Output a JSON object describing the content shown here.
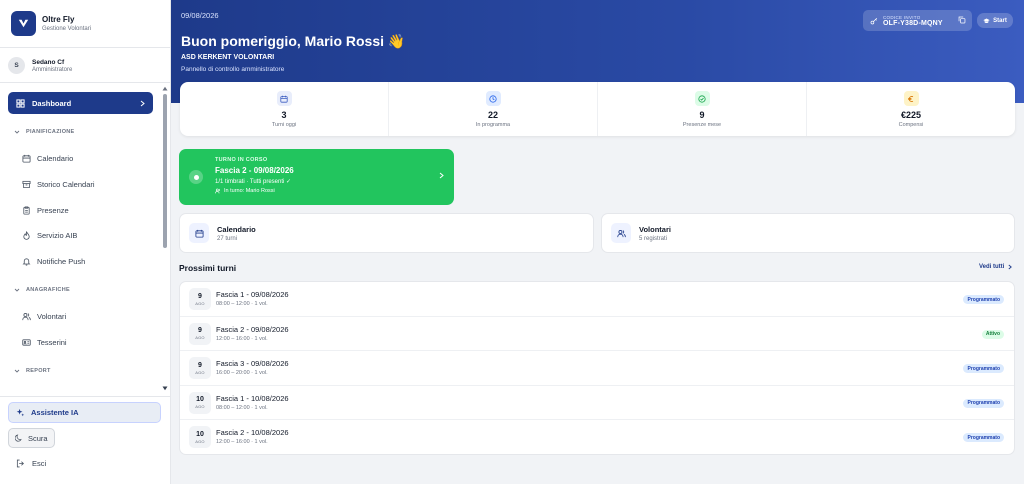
{
  "brand": {
    "name": "Oltre Fly",
    "subtitle": "Gestione Volontari"
  },
  "user": {
    "initial": "S",
    "name": "Sedano Cf",
    "role": "Amministratore"
  },
  "nav": {
    "dashboard": "Dashboard",
    "sections": {
      "pianificazione": "PIANIFICAZIONE",
      "anagrafiche": "ANAGRAFICHE",
      "report": "REPORT"
    },
    "items": {
      "calendario": "Calendario",
      "storico": "Storico Calendari",
      "presenze": "Presenze",
      "aib": "Servizio AIB",
      "notifiche": "Notifiche Push",
      "volontari": "Volontari",
      "tesserini": "Tesserini"
    },
    "assistente": "Assistente IA",
    "scura": "Scura",
    "esci": "Esci"
  },
  "header": {
    "date": "09/08/2026",
    "greeting": "Buon pomeriggio, Mario Rossi 👋",
    "org": "ASD KERKENT VOLONTARI",
    "panel": "Pannello di controllo amministratore",
    "invite_label": "CODICE INVITO",
    "invite_code": "OLF-Y38D-MQNY",
    "start": "Start"
  },
  "stats": [
    {
      "value": "3",
      "label": "Turni oggi",
      "color": "#3b5cc0",
      "bg": "#e8edfb"
    },
    {
      "value": "22",
      "label": "In programma",
      "color": "#2563eb",
      "bg": "#e0ebff"
    },
    {
      "value": "9",
      "label": "Presenze mese",
      "color": "#16a34a",
      "bg": "#dcfce7"
    },
    {
      "value": "€225",
      "label": "Compensi",
      "color": "#d97706",
      "bg": "#fef3c7"
    }
  ],
  "shift": {
    "badge": "TURNO IN CORSO",
    "title": "Fascia 2 - 09/08/2026",
    "status": "1/1 timbrati · Tutti presenti ✓",
    "who": "In turno: Mario Rossi"
  },
  "quick": {
    "calendario": {
      "title": "Calendario",
      "sub": "27 turni"
    },
    "volontari": {
      "title": "Volontari",
      "sub": "5 registrati"
    }
  },
  "upcoming": {
    "title": "Prossimi turni",
    "link": "Vedi tutti",
    "rows": [
      {
        "day": "9",
        "month": "AGO",
        "title": "Fascia 1 - 09/08/2026",
        "sub": "08:00 – 12:00 · 1 vol.",
        "status": "Programmato",
        "kind": "blue"
      },
      {
        "day": "9",
        "month": "AGO",
        "title": "Fascia 2 - 09/08/2026",
        "sub": "12:00 – 16:00 · 1 vol.",
        "status": "Attivo",
        "kind": "green"
      },
      {
        "day": "9",
        "month": "AGO",
        "title": "Fascia 3 - 09/08/2026",
        "sub": "16:00 – 20:00 · 1 vol.",
        "status": "Programmato",
        "kind": "blue"
      },
      {
        "day": "10",
        "month": "AGO",
        "title": "Fascia 1 - 10/08/2026",
        "sub": "08:00 – 12:00 · 1 vol.",
        "status": "Programmato",
        "kind": "blue"
      },
      {
        "day": "10",
        "month": "AGO",
        "title": "Fascia 2 - 10/08/2026",
        "sub": "12:00 – 16:00 · 1 vol.",
        "status": "Programmato",
        "kind": "blue"
      }
    ]
  }
}
